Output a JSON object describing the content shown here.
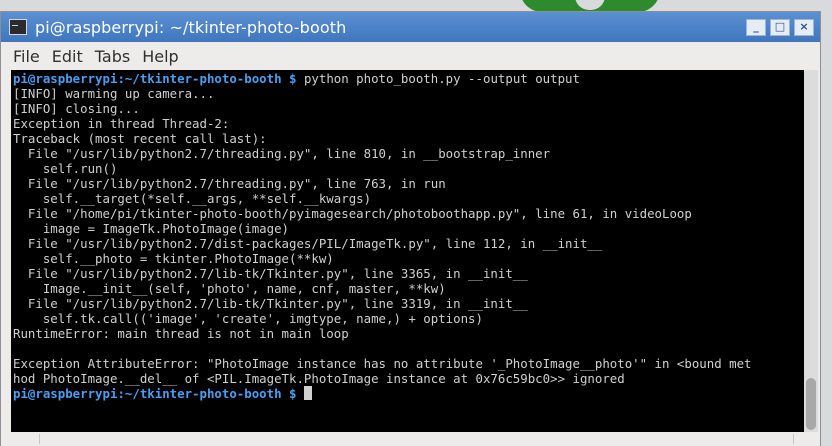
{
  "window": {
    "title": "pi@raspberrypi: ~/tkinter-photo-booth",
    "buttons": {
      "minimize": "_",
      "maximize": "□",
      "close": "×"
    }
  },
  "menu": [
    "File",
    "Edit",
    "Tabs",
    "Help"
  ],
  "terminal": {
    "prompt1": {
      "user": "pi@raspberrypi",
      "path": ":~/tkinter-photo-booth $",
      "command": " python photo_booth.py --output output"
    },
    "lines": [
      "[INFO] warming up camera...",
      "[INFO] closing...",
      "Exception in thread Thread-2:",
      "Traceback (most recent call last):",
      "  File \"/usr/lib/python2.7/threading.py\", line 810, in __bootstrap_inner",
      "    self.run()",
      "  File \"/usr/lib/python2.7/threading.py\", line 763, in run",
      "    self.__target(*self.__args, **self.__kwargs)",
      "  File \"/home/pi/tkinter-photo-booth/pyimagesearch/photoboothapp.py\", line 61, in videoLoop",
      "    image = ImageTk.PhotoImage(image)",
      "  File \"/usr/lib/python2.7/dist-packages/PIL/ImageTk.py\", line 112, in __init__",
      "    self.__photo = tkinter.PhotoImage(**kw)",
      "  File \"/usr/lib/python2.7/lib-tk/Tkinter.py\", line 3365, in __init__",
      "    Image.__init__(self, 'photo', name, cnf, master, **kw)",
      "  File \"/usr/lib/python2.7/lib-tk/Tkinter.py\", line 3319, in __init__",
      "    self.tk.call(('image', 'create', imgtype, name,) + options)",
      "RuntimeError: main thread is not in main loop",
      "",
      "Exception AttributeError: \"PhotoImage instance has no attribute '_PhotoImage__photo'\" in <bound met",
      "hod PhotoImage.__del__ of <PIL.ImageTk.PhotoImage instance at 0x76c59bc0>> ignored"
    ],
    "prompt2": {
      "user": "pi@raspberrypi",
      "path": ":~/tkinter-photo-booth $",
      "command": " "
    }
  },
  "colors": {
    "titlebar": "#4a80c6",
    "terminal_bg": "#000000",
    "terminal_fg": "#cfcfcf",
    "prompt": "#4a9ef0"
  },
  "icons": {
    "app": "terminal-icon"
  }
}
